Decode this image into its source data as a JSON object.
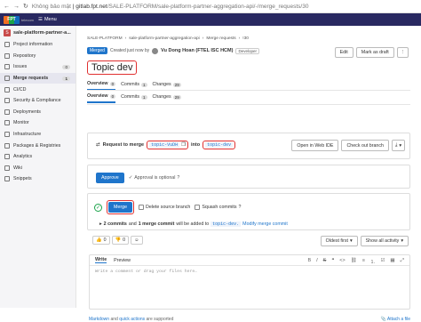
{
  "browser": {
    "back": "←",
    "forward": "→",
    "reload": "↻",
    "security": "Không bảo mật",
    "url_host": "gitlab.fpt.net",
    "url_path": "/SALE-PLATFORM/sale-platform-partner-aggregation-api/-/merge_requests/30"
  },
  "topbar": {
    "logo_text": "FPT",
    "logo_sub": "telecom",
    "menu_label": "Menu"
  },
  "sidebar": {
    "project_initial": "S",
    "project_name": "sale-platform-partner-a...",
    "items": [
      {
        "label": "Project information"
      },
      {
        "label": "Repository"
      },
      {
        "label": "Issues",
        "badge": "0"
      },
      {
        "label": "Merge requests",
        "badge": "1"
      },
      {
        "label": "CI/CD"
      },
      {
        "label": "Security & Compliance"
      },
      {
        "label": "Deployments"
      },
      {
        "label": "Monitor"
      },
      {
        "label": "Infrastructure"
      },
      {
        "label": "Packages & Registries"
      },
      {
        "label": "Analytics"
      },
      {
        "label": "Wiki"
      },
      {
        "label": "Snippets"
      }
    ]
  },
  "breadcrumb": {
    "group": "SALE-PLATFORM",
    "project": "sale-platform-partner-aggregation-api",
    "section": "Merge requests",
    "id": "!30",
    "sep": "›"
  },
  "mr": {
    "status": "Merged",
    "created_text": "Created just now by",
    "author": "Vu Dong Hoan (FTEL ISC HCM)",
    "role": "Developer",
    "title": "Topic dev",
    "edit_label": "Edit",
    "mark_draft_label": "Mark as draft"
  },
  "tabs": {
    "overview_label": "Overview",
    "overview_count": "0",
    "commits_label": "Commits",
    "commits_count": "1",
    "changes_label": "Changes",
    "changes_count": "29"
  },
  "request": {
    "prefix": "Request to merge",
    "source": "topic-VuDH",
    "into": "into",
    "target": "topic-dev",
    "open_webide_label": "Open in Web IDE",
    "checkout_label": "Check out branch"
  },
  "approval": {
    "approve_label": "Approve",
    "optional_text": "Approval is optional"
  },
  "merge": {
    "merge_label": "Merge",
    "delete_source_label": "Delete source branch",
    "squash_label": "Squash commits",
    "commits_count_text": "2 commits",
    "and_text": "and",
    "merge_commit_text": "1 merge commit",
    "added_text": "will be added to",
    "target_branch": "topic-dev.",
    "modify_link": "Modify merge commit"
  },
  "reactions": {
    "thumbs_up": "0",
    "thumbs_down": "0"
  },
  "sort": {
    "oldest_first": "Oldest first",
    "show_all": "Show all activity"
  },
  "editor": {
    "write_tab": "Write",
    "preview_tab": "Preview",
    "placeholder": "Write a comment or drag your files here…",
    "markdown_link": "Markdown",
    "and_text": "and",
    "quick_actions_link": "quick actions",
    "supported_text": "are supported",
    "attach_label": "Attach a file"
  }
}
